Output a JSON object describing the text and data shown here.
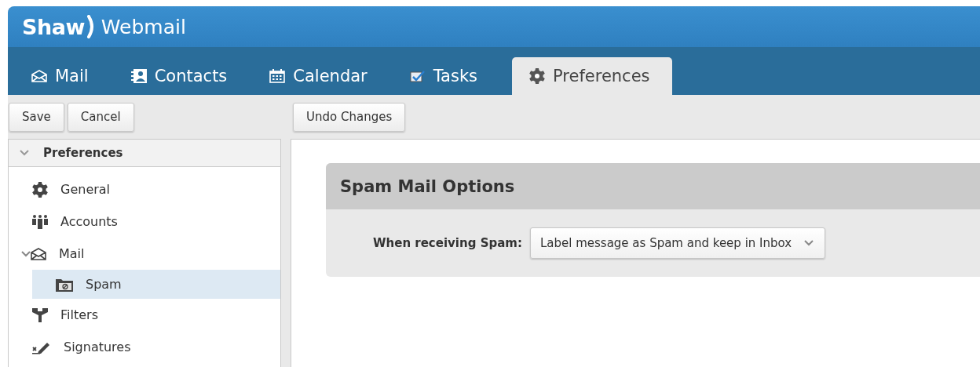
{
  "header": {
    "brand": "Shaw",
    "product": "Webmail"
  },
  "tabs": [
    {
      "label": "Mail",
      "selected": false
    },
    {
      "label": "Contacts",
      "selected": false
    },
    {
      "label": "Calendar",
      "selected": false
    },
    {
      "label": "Tasks",
      "selected": false
    },
    {
      "label": "Preferences",
      "selected": true
    }
  ],
  "toolbar": {
    "left_buttons": [
      "Save",
      "Cancel"
    ],
    "right_buttons": [
      "Undo Changes"
    ]
  },
  "sidebar": {
    "title": "Preferences",
    "expanded": true,
    "items": [
      {
        "label": "General",
        "selected": false
      },
      {
        "label": "Accounts",
        "selected": false
      },
      {
        "label": "Mail",
        "selected": false,
        "expanded": true,
        "children": [
          {
            "label": "Spam",
            "selected": true
          }
        ]
      },
      {
        "label": "Filters",
        "selected": false
      },
      {
        "label": "Signatures",
        "selected": false
      }
    ]
  },
  "panel": {
    "title": "Spam Mail Options",
    "field": {
      "label": "When receiving Spam:",
      "value": "Label message as Spam and keep in Inbox"
    }
  }
}
